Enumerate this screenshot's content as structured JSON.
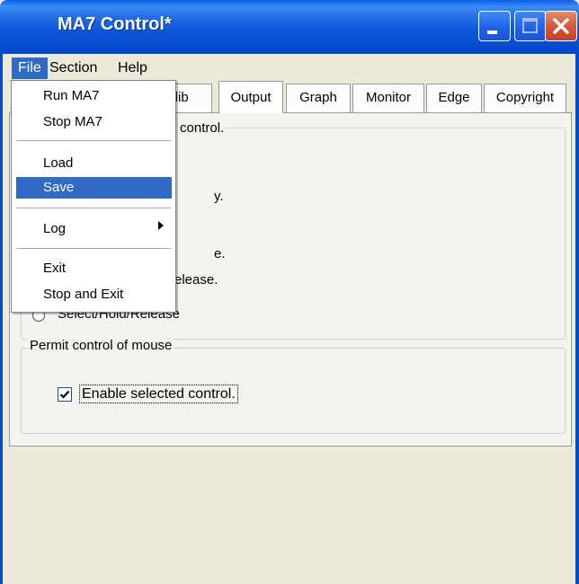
{
  "window": {
    "title": "MA7 Control*"
  },
  "menu": {
    "file": "File",
    "section": "Section",
    "help": "Help"
  },
  "file_menu": {
    "run": "Run MA7",
    "stop": "Stop MA7",
    "load": "Load",
    "save": "Save",
    "log": "Log",
    "exit": "Exit",
    "stop_and_exit": "Stop and Exit"
  },
  "tabs": {
    "calib": "alib",
    "output": "Output",
    "graph": "Graph",
    "monitor": "Monitor",
    "edge": "Edge",
    "copyright": "Copyright"
  },
  "mouse_group": {
    "legend": "se control.",
    "frag1": "y.",
    "frag2": "e.",
    "frag3": "elease.",
    "last_radio": "Select/Hold/Release"
  },
  "permit_group": {
    "legend": "Permit control of mouse",
    "checkbox_label": "Enable selected control.",
    "checkbox_checked": true
  },
  "colors": {
    "titlebar": "#0747c9",
    "menu_highlight": "#316ac5",
    "face": "#ece9d8"
  }
}
